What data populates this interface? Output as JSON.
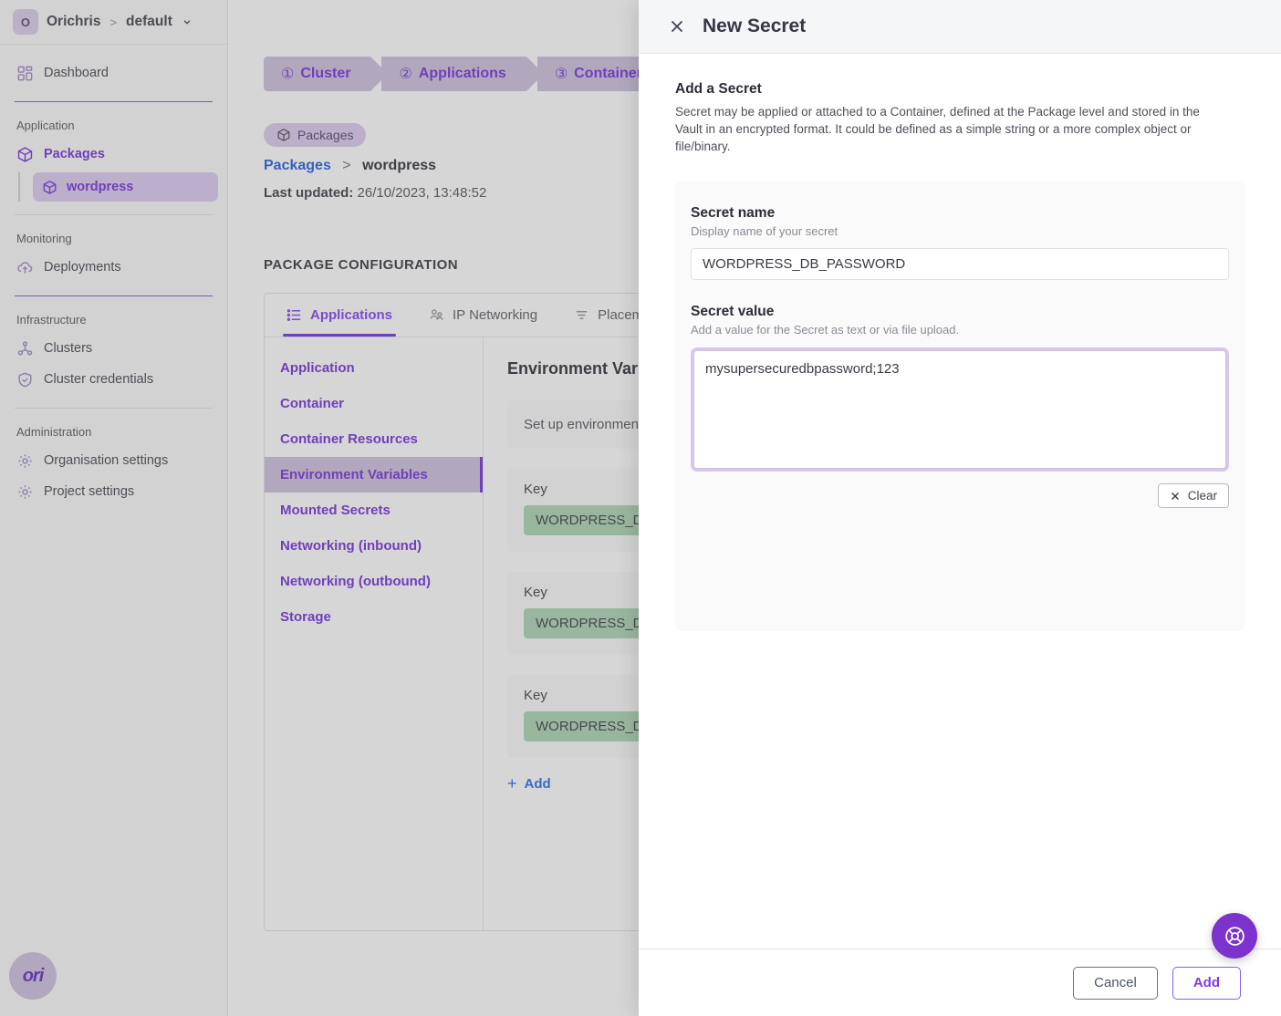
{
  "sidebar": {
    "org": {
      "avatar_initial": "O",
      "name": "Orichris",
      "separator": ">",
      "project": "default"
    },
    "dashboard": {
      "label": "Dashboard",
      "icon": "grid-icon"
    },
    "groups": [
      {
        "title": "Application"
      },
      {
        "title": "Monitoring"
      },
      {
        "title": "Infrastructure"
      },
      {
        "title": "Administration"
      }
    ],
    "packages": {
      "label": "Packages",
      "icon": "package-icon"
    },
    "package_child": {
      "label": "wordpress",
      "icon": "package-icon"
    },
    "deployments": {
      "label": "Deployments",
      "icon": "cloud-upload-icon"
    },
    "clusters": {
      "label": "Clusters",
      "icon": "cluster-icon"
    },
    "cluster_credentials": {
      "label": "Cluster credentials",
      "icon": "shield-check-icon"
    },
    "organisation_settings": {
      "label": "Organisation settings",
      "icon": "gear-icon"
    },
    "project_settings": {
      "label": "Project settings",
      "icon": "gear-icon"
    },
    "brand": "ori"
  },
  "main": {
    "stepper": [
      {
        "num": "①",
        "label": "Cluster"
      },
      {
        "num": "②",
        "label": "Applications"
      },
      {
        "num": "③",
        "label": "Containers"
      }
    ],
    "package_chip": "Packages",
    "breadcrumb": {
      "root": "Packages",
      "separator": ">",
      "current": "wordpress"
    },
    "last_updated_label": "Last updated:",
    "last_updated_value": "26/10/2023, 13:48:52",
    "section_title": "PACKAGE CONFIGURATION",
    "tabs": [
      {
        "label": "Applications",
        "icon": "list-icon",
        "active": true
      },
      {
        "label": "IP Networking",
        "icon": "network-icon",
        "active": false
      },
      {
        "label": "Placement",
        "icon": "filter-icon",
        "active": false
      }
    ],
    "config_nav": [
      {
        "label": "Application",
        "active": false
      },
      {
        "label": "Container",
        "active": false
      },
      {
        "label": "Container Resources",
        "active": false
      },
      {
        "label": "Environment Variables",
        "active": true
      },
      {
        "label": "Mounted Secrets",
        "active": false
      },
      {
        "label": "Networking (inbound)",
        "active": false
      },
      {
        "label": "Networking (outbound)",
        "active": false
      },
      {
        "label": "Storage",
        "active": false
      }
    ],
    "pane": {
      "title": "Environment Variables",
      "description": "Set up environment variables for your container. Reference secrets you have already saved.",
      "rows": [
        {
          "key_label": "Key",
          "key_value": "WORDPRESS_DB_HOST"
        },
        {
          "key_label": "Key",
          "key_value": "WORDPRESS_DB_USER"
        },
        {
          "key_label": "Key",
          "key_value": "WORDPRESS_DB_NAME"
        }
      ],
      "add_label": "Add"
    }
  },
  "drawer": {
    "title": "New Secret",
    "close_icon": "close-icon",
    "heading": "Add a Secret",
    "description": "Secret may be applied or attached to a Container, defined at the Package level and stored in the Vault in an encrypted format. It could be defined as a simple string or a more complex object or file/binary.",
    "secret_name": {
      "label": "Secret name",
      "hint": "Display name of your secret",
      "value": "WORDPRESS_DB_PASSWORD",
      "placeholder": "Secret name"
    },
    "secret_value": {
      "label": "Secret value",
      "hint": "Add a value for the Secret as text or via file upload.",
      "value": "mysupersecuredbpassword;123",
      "placeholder": "Secret value"
    },
    "clear_label": "Clear",
    "cancel_label": "Cancel",
    "add_label": "Add"
  },
  "fab": {
    "icon": "lifebuoy-icon"
  },
  "colors": {
    "accent_purple": "#6d28d9",
    "accent_purple_light": "#cbbddd",
    "link_blue": "#2563eb",
    "pill_green": "#a8d3b0",
    "fab_purple": "#7c32cc"
  }
}
